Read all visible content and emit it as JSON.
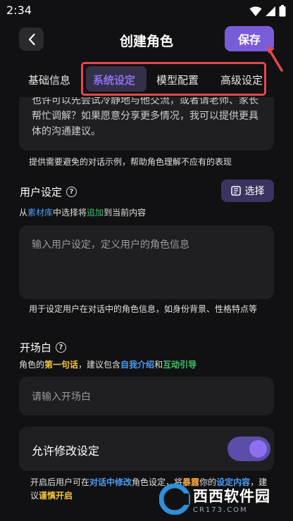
{
  "status_bar": {
    "time": "2:34"
  },
  "header": {
    "title": "创建角色",
    "save_label": "保存"
  },
  "tabs": [
    {
      "label": "基础信息"
    },
    {
      "label": "系统设定"
    },
    {
      "label": "模型配置"
    },
    {
      "label": "高级设定"
    }
  ],
  "active_tab": "系统设定",
  "avoid_examples": {
    "text": "也许可以先尝试冷静地与他交流，或者请老师、家长帮忙调解？如果愿意分享更多情况，我可以提供更具体的沟通建议。",
    "helper": "提供需要避免的对话示例，帮助角色理解不应有的表现"
  },
  "user_setting": {
    "title": "用户设定",
    "select_label": "选择",
    "note_prefix": "从",
    "note_library": "素材库",
    "note_mid": "中选择将",
    "note_append": "追加",
    "note_suffix": "到当前内容",
    "placeholder": "输入用户设定，定义用户的角色信息",
    "helper": "用于设定用户在对话中的角色信息，如身份背景、性格特点等"
  },
  "opening": {
    "title": "开场白",
    "note_prefix": "角色的",
    "note_first": "第一句话",
    "note_mid": "，建议包含",
    "note_intro": "自我介绍",
    "note_and": "和",
    "note_guide": "互动引导",
    "placeholder": "请输入开场白"
  },
  "allow_edit": {
    "label": "允许修改设定",
    "enabled": true,
    "note_1": "开启后用户可在",
    "note_2": "对话中修改",
    "note_3": "角色设定，将",
    "note_4": "暴露",
    "note_5": "你的",
    "note_6": "设定内容",
    "note_7": "，建议",
    "note_8": "谨慎开启"
  },
  "watermark": {
    "brand": "西西软件园",
    "domain": "CR173.COM"
  },
  "colors": {
    "accent": "#7a5bd8",
    "highlight_box": "#e5484a",
    "blue": "#4b9cf5",
    "green": "#3fc46a",
    "yellow": "#f3c53a"
  }
}
